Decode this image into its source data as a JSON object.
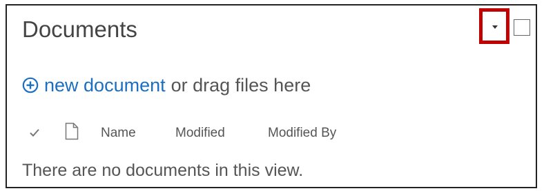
{
  "webpart": {
    "title": "Documents"
  },
  "toolbar": {
    "new_link_label": "new document",
    "drag_text": "or drag files here",
    "icons": {
      "new": "plus-circle-icon",
      "menu": "caret-down-icon"
    }
  },
  "list": {
    "columns": [
      "Name",
      "Modified",
      "Modified By"
    ],
    "empty_message": "There are no documents in this view."
  },
  "colors": {
    "link": "#1b6ec2",
    "highlight": "#c00000",
    "text": "#444444"
  }
}
